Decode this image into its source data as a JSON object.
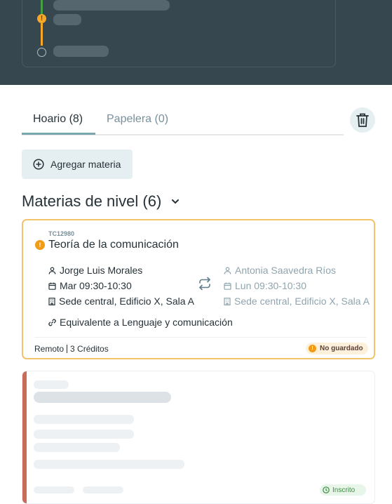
{
  "tabs": {
    "hoario": "Hoario (8)",
    "papelera": "Papelera (0)"
  },
  "add_button": {
    "label": "Agregar materia"
  },
  "section": {
    "title": "Materias de nivel (6)"
  },
  "course": {
    "code": "TC12980",
    "name": "Teoría de la comunicación",
    "current": {
      "teacher": "Jorge Luis Morales",
      "schedule": "Mar 09:30-10:30",
      "location": "Sede central, Edificio X, Sala A"
    },
    "alternative": {
      "teacher": "Antonia Saavedra Ríos",
      "schedule": "Lun 09:30-10:30",
      "location": "Sede central, Edificio X, Sala A"
    },
    "equivalence_prefix": "Equivalente a ",
    "equivalence_course": "Lenguaje y comunicación",
    "modality": "Remoto",
    "credits": "3 Créditos",
    "status": "No guardado"
  },
  "skeleton_card": {
    "status": "Inscrito"
  },
  "colors": {
    "accent": "#7aa7ad",
    "warning": "#f29b16",
    "header_bg": "#37474f",
    "card_border": "#f2c36b",
    "skeleton_bar": "#c96b5a"
  }
}
